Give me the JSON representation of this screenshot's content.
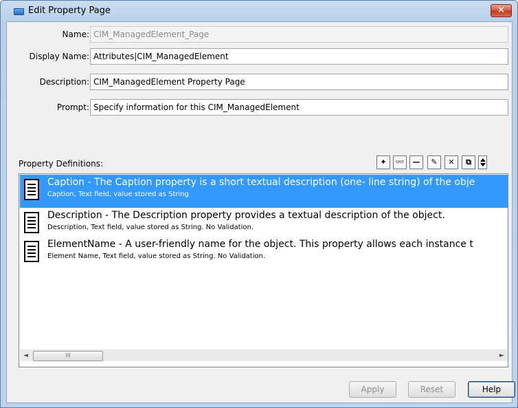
{
  "window": {
    "title": "Edit Property Page",
    "close_glyph": "✕"
  },
  "form": {
    "name_label": "Name:",
    "name_value": "CIM_ManagedElement_Page",
    "display_name_label": "Display Name:",
    "display_name_value": "Attributes|CIM_ManagedElement",
    "description_label": "Description:",
    "description_value": "CIM_ManagedElement Property Page",
    "prompt_label": "Prompt:",
    "prompt_value": "Specify information for this CIM_ManagedElement"
  },
  "property_definitions": {
    "label": "Property Definitions:",
    "toolbar": [
      {
        "name": "new-icon",
        "glyph": "✦"
      },
      {
        "name": "find-icon",
        "glyph": "👓"
      },
      {
        "name": "separator-icon",
        "glyph": "—"
      },
      {
        "name": "edit-icon",
        "glyph": "✎"
      },
      {
        "name": "delete-icon",
        "glyph": "✕"
      },
      {
        "name": "copy-icon",
        "glyph": "⧉"
      },
      {
        "name": "move-updown-icon",
        "glyph": ""
      }
    ],
    "items": [
      {
        "title": "Caption - The Caption property is a short textual description (one- line string) of the obje",
        "subtitle": "Caption, Text field, value stored as String",
        "selected": true
      },
      {
        "title": "Description - The Description property provides a textual description of the object.",
        "subtitle": "Description, Text field, value stored as String. No Validation.",
        "selected": false
      },
      {
        "title": "ElementName - A user-friendly name for the object. This property allows each instance t",
        "subtitle": "Element Name, Text field, value stored as String. No Validation.",
        "selected": false
      }
    ],
    "scroll": {
      "left": "◄",
      "right": "►",
      "thumb": "III"
    }
  },
  "buttons": {
    "apply": "Apply",
    "reset": "Reset",
    "help": "Help"
  },
  "colors": {
    "selection": "#3399ff",
    "title_bar": "#b9d1ea",
    "close": "#c23b22"
  }
}
